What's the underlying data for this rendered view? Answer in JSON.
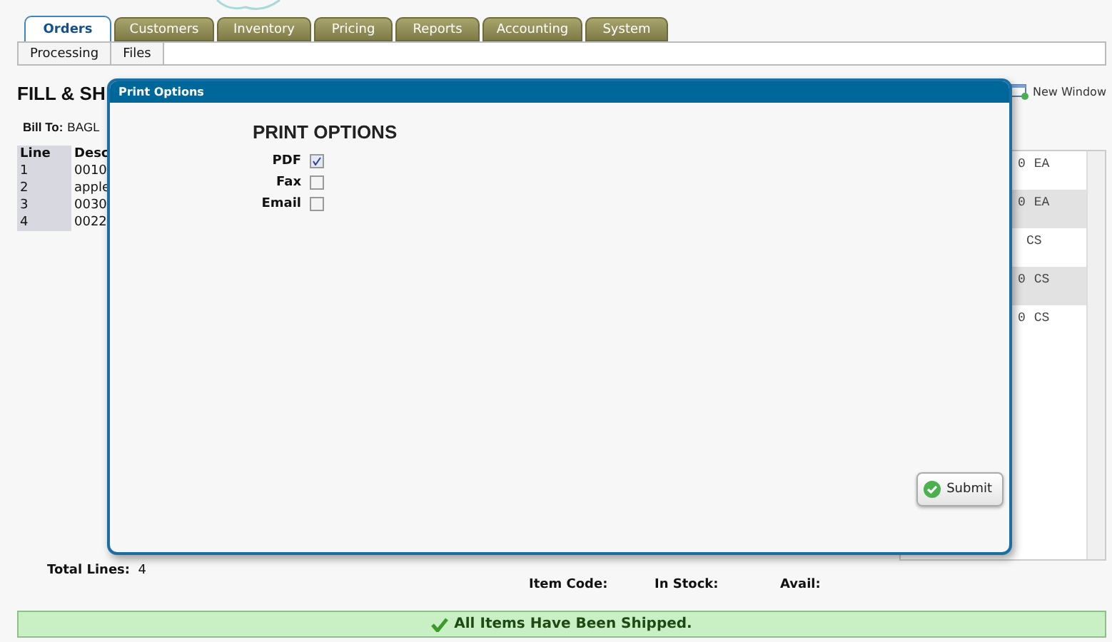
{
  "tabs": [
    {
      "label": "Orders",
      "selected": true
    },
    {
      "label": "Customers",
      "selected": false
    },
    {
      "label": "Inventory",
      "selected": false
    },
    {
      "label": "Pricing",
      "selected": false
    },
    {
      "label": "Reports",
      "selected": false
    },
    {
      "label": "Accounting",
      "selected": false
    },
    {
      "label": "System",
      "selected": false
    }
  ],
  "subtabs": [
    "Processing",
    "Files"
  ],
  "page_title": "FILL & SH",
  "bill_to": {
    "label": "Bill To:",
    "value": "BAGL"
  },
  "lines_table": {
    "columns": [
      "Line",
      "Desc"
    ],
    "rows": [
      [
        "1",
        "0010"
      ],
      [
        "2",
        "apple"
      ],
      [
        "3",
        "0030"
      ],
      [
        "4",
        "0022"
      ]
    ]
  },
  "new_window": "New Window",
  "item_list": [
    {
      "qty": "0",
      "unit": "EA",
      "shaded": false
    },
    {
      "qty": "0",
      "unit": "EA",
      "shaded": true
    },
    {
      "unit": "CS",
      "shaded": false
    },
    {
      "qty": "0",
      "unit": "CS",
      "shaded": true
    },
    {
      "qty": "0",
      "unit": "CS",
      "shaded": false
    }
  ],
  "total_lines": {
    "label": "Total Lines:",
    "value": "4"
  },
  "item_fields": [
    "Item Code:",
    "In Stock:",
    "Avail:"
  ],
  "status_message": "All Items Have Been Shipped.",
  "dialog": {
    "title": "Print Options",
    "heading": "PRINT OPTIONS",
    "options": [
      {
        "label": "PDF",
        "checked": true
      },
      {
        "label": "Fax",
        "checked": false
      },
      {
        "label": "Email",
        "checked": false
      }
    ],
    "submit": "Submit"
  }
}
